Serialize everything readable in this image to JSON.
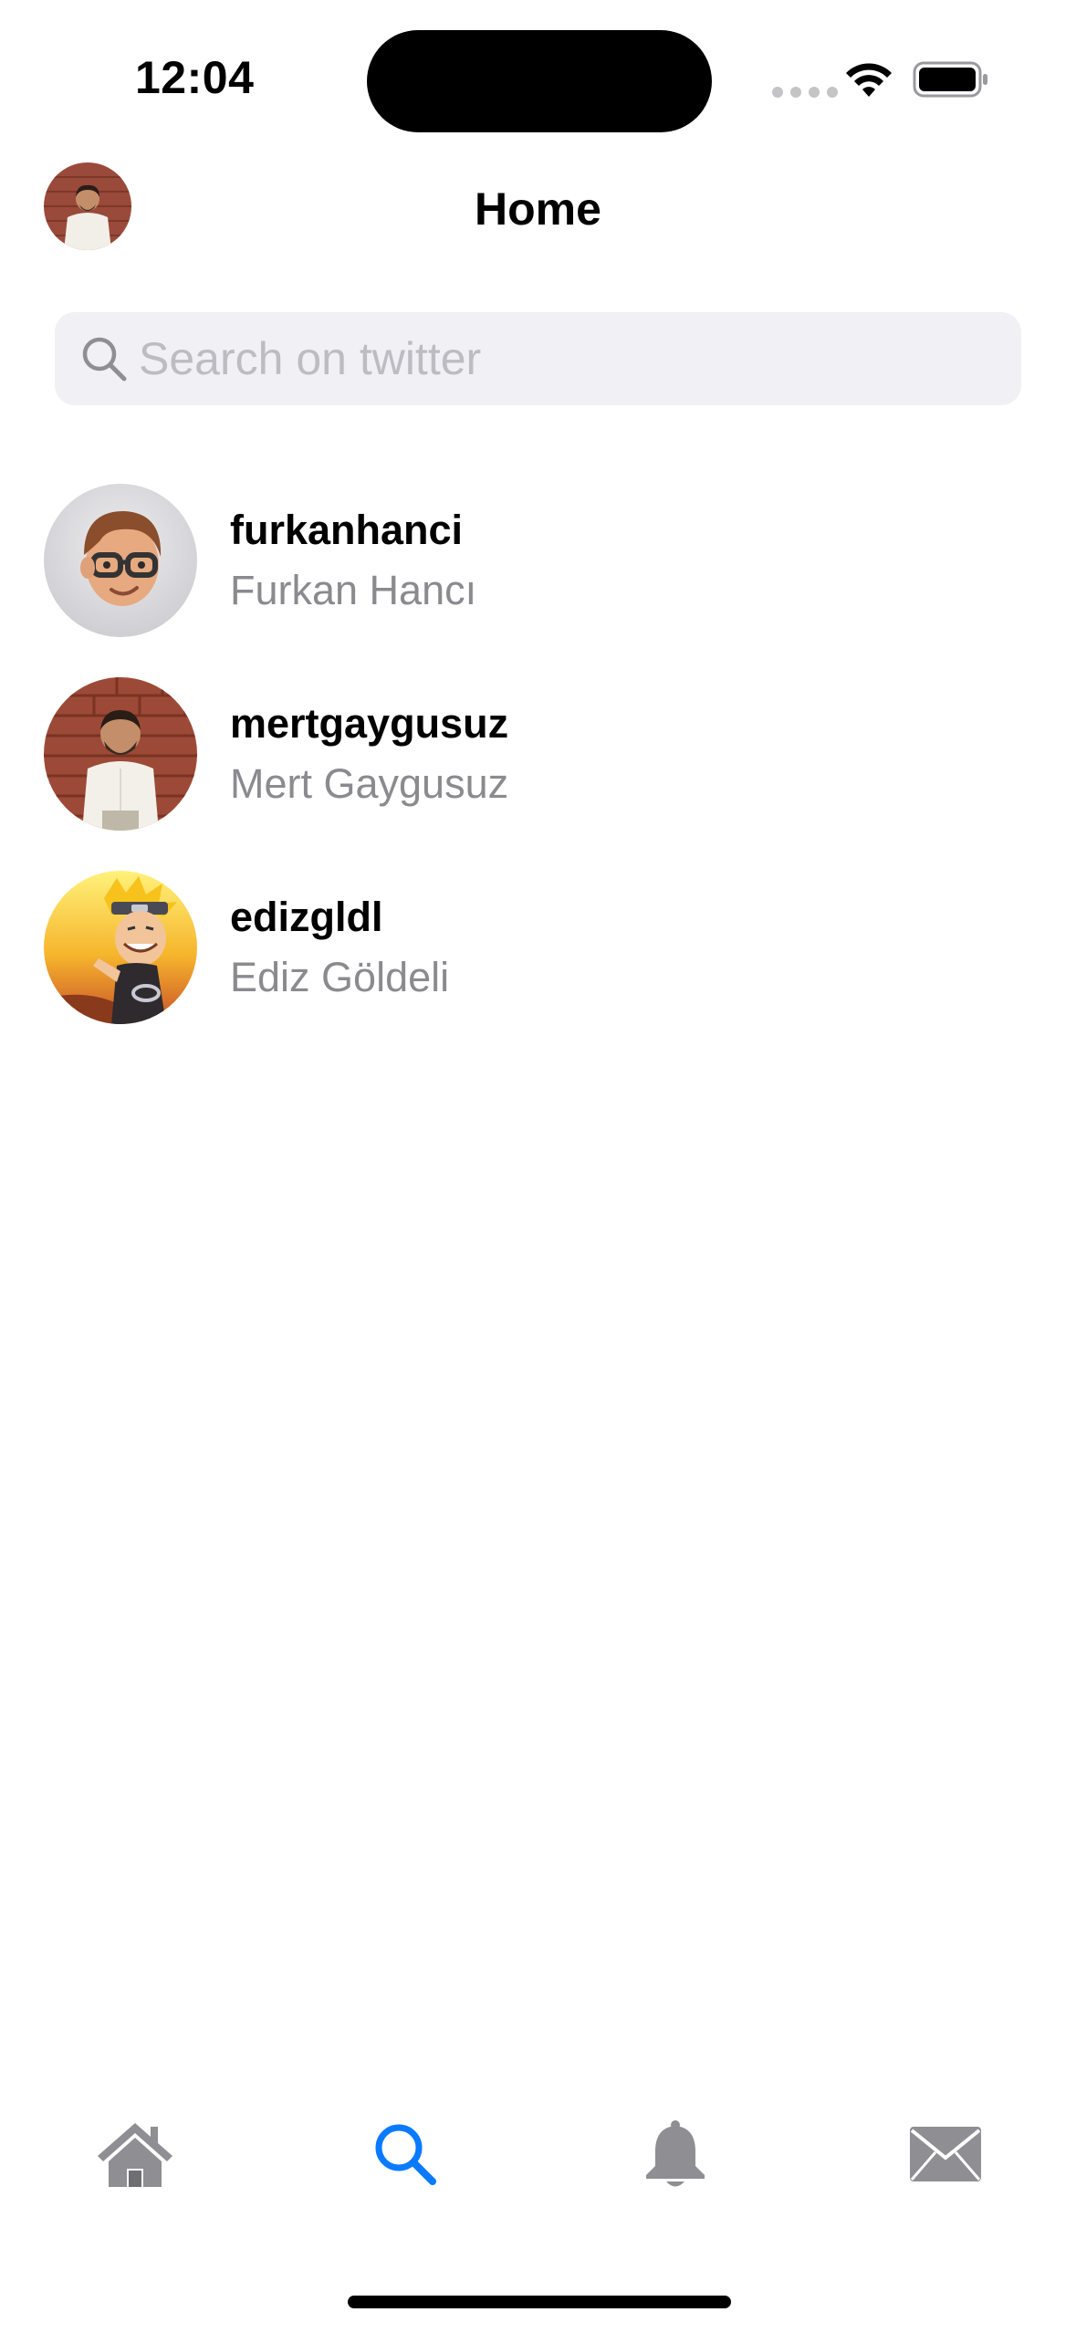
{
  "status_bar": {
    "time": "12:04"
  },
  "nav": {
    "title": "Home"
  },
  "search": {
    "placeholder": "Search on twitter",
    "value": ""
  },
  "users": [
    {
      "handle": "furkanhanci",
      "name": "Furkan Hancı",
      "avatar": "memoji-avatar"
    },
    {
      "handle": "mertgaygusuz",
      "name": "Mert Gaygusuz",
      "avatar": "photo-avatar"
    },
    {
      "handle": "edizgldl",
      "name": "Ediz Göldeli",
      "avatar": "anime-avatar"
    }
  ],
  "tabs": [
    {
      "icon": "house-icon",
      "selected": false
    },
    {
      "icon": "magnifying-glass-icon",
      "selected": true
    },
    {
      "icon": "bell-icon",
      "selected": false
    },
    {
      "icon": "envelope-icon",
      "selected": false
    }
  ],
  "colors": {
    "accent": "#0a7aff",
    "tab_inactive": "#8e8e93",
    "secondary_text": "#8a8a8f",
    "search_bg": "#f0f0f5"
  }
}
